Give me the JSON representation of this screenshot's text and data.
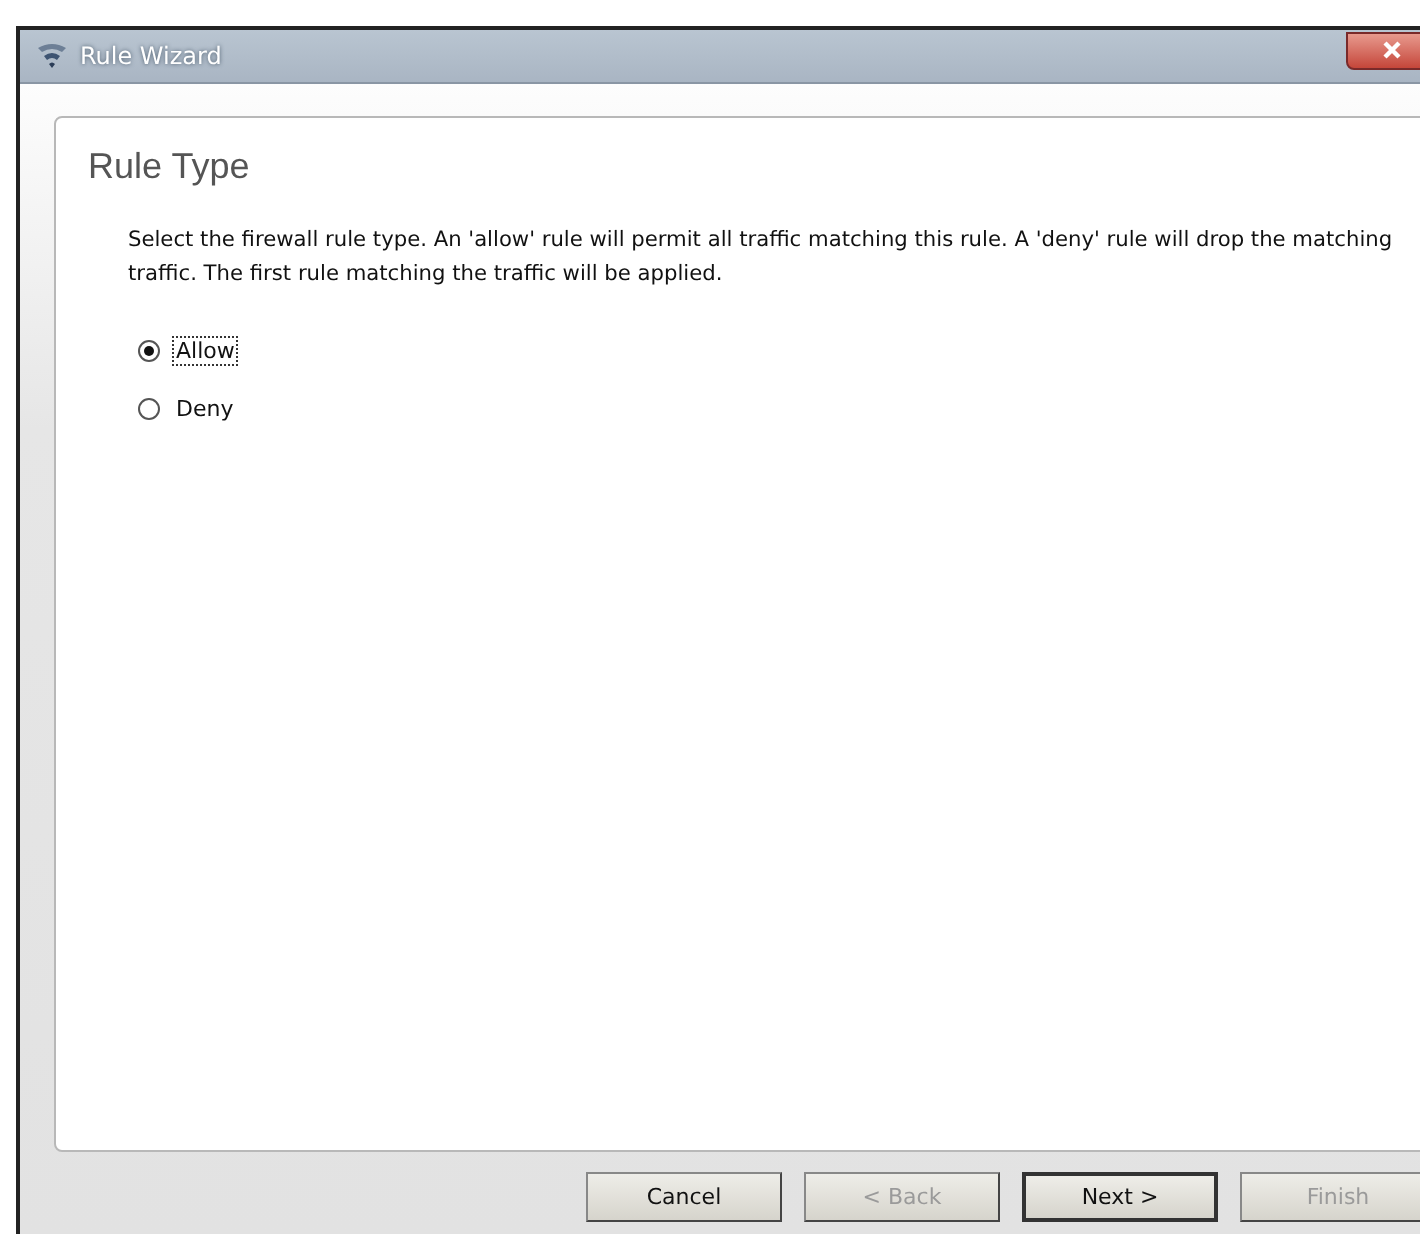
{
  "window": {
    "title": "Rule Wizard"
  },
  "page": {
    "heading": "Rule Type",
    "description": "Select the firewall rule type. An 'allow' rule will permit all traffic matching this rule. A 'deny' rule will drop the matching traffic. The first rule matching the traffic will be applied."
  },
  "options": [
    {
      "label": "Allow",
      "selected": true
    },
    {
      "label": "Deny",
      "selected": false
    }
  ],
  "buttons": [
    {
      "label": "Cancel",
      "disabled": false,
      "default": false
    },
    {
      "label": "< Back",
      "disabled": true,
      "default": false
    },
    {
      "label": "Next >",
      "disabled": false,
      "default": true
    },
    {
      "label": "Finish",
      "disabled": true,
      "default": false
    }
  ]
}
